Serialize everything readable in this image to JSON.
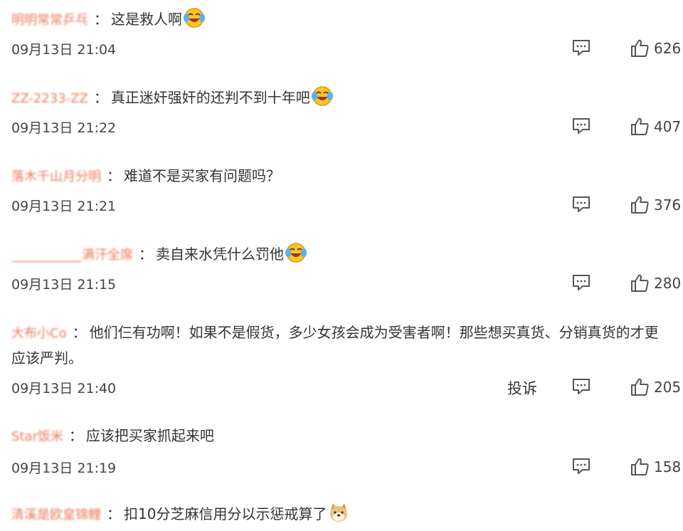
{
  "comments": [
    {
      "user": "明明常常乒乓",
      "text": "这是救人啊",
      "emoji": "laugh-cry",
      "time": "09月13日 21:04",
      "likes": "626"
    },
    {
      "user": "ZZ-2233-ZZ",
      "text": "真正迷奸强奸的还判不到十年吧",
      "emoji": "laugh-cry",
      "time": "09月13日 21:22",
      "likes": "407"
    },
    {
      "user": "落木千山月分明",
      "text": "难道不是买家有问题吗？",
      "emoji": "",
      "time": "09月13日 21:21",
      "likes": "376"
    },
    {
      "user": "___________满汗全席",
      "text": "卖自来水凭什么罚他",
      "emoji": "laugh-cry",
      "time": "09月13日 21:15",
      "likes": "280"
    },
    {
      "user": "大布小Co",
      "text": "他们仨有功啊！如果不是假货，多少女孩会成为受害者啊！那些想买真货、分销真货的才更应该严判。",
      "emoji": "",
      "time": "09月13日 21:40",
      "likes": "205",
      "report": "投诉"
    },
    {
      "user": "Star饭米",
      "text": "应该把买家抓起来吧",
      "emoji": "",
      "time": "09月13日 21:19",
      "likes": "158"
    },
    {
      "user": "清溪是欧皇锦鲤",
      "text": "扣10分芝麻信用分以示惩戒算了",
      "emoji": "doge",
      "time": "",
      "likes": ""
    }
  ],
  "colors": {
    "username": "#e8623f",
    "text": "#333333",
    "meta": "#444444"
  }
}
